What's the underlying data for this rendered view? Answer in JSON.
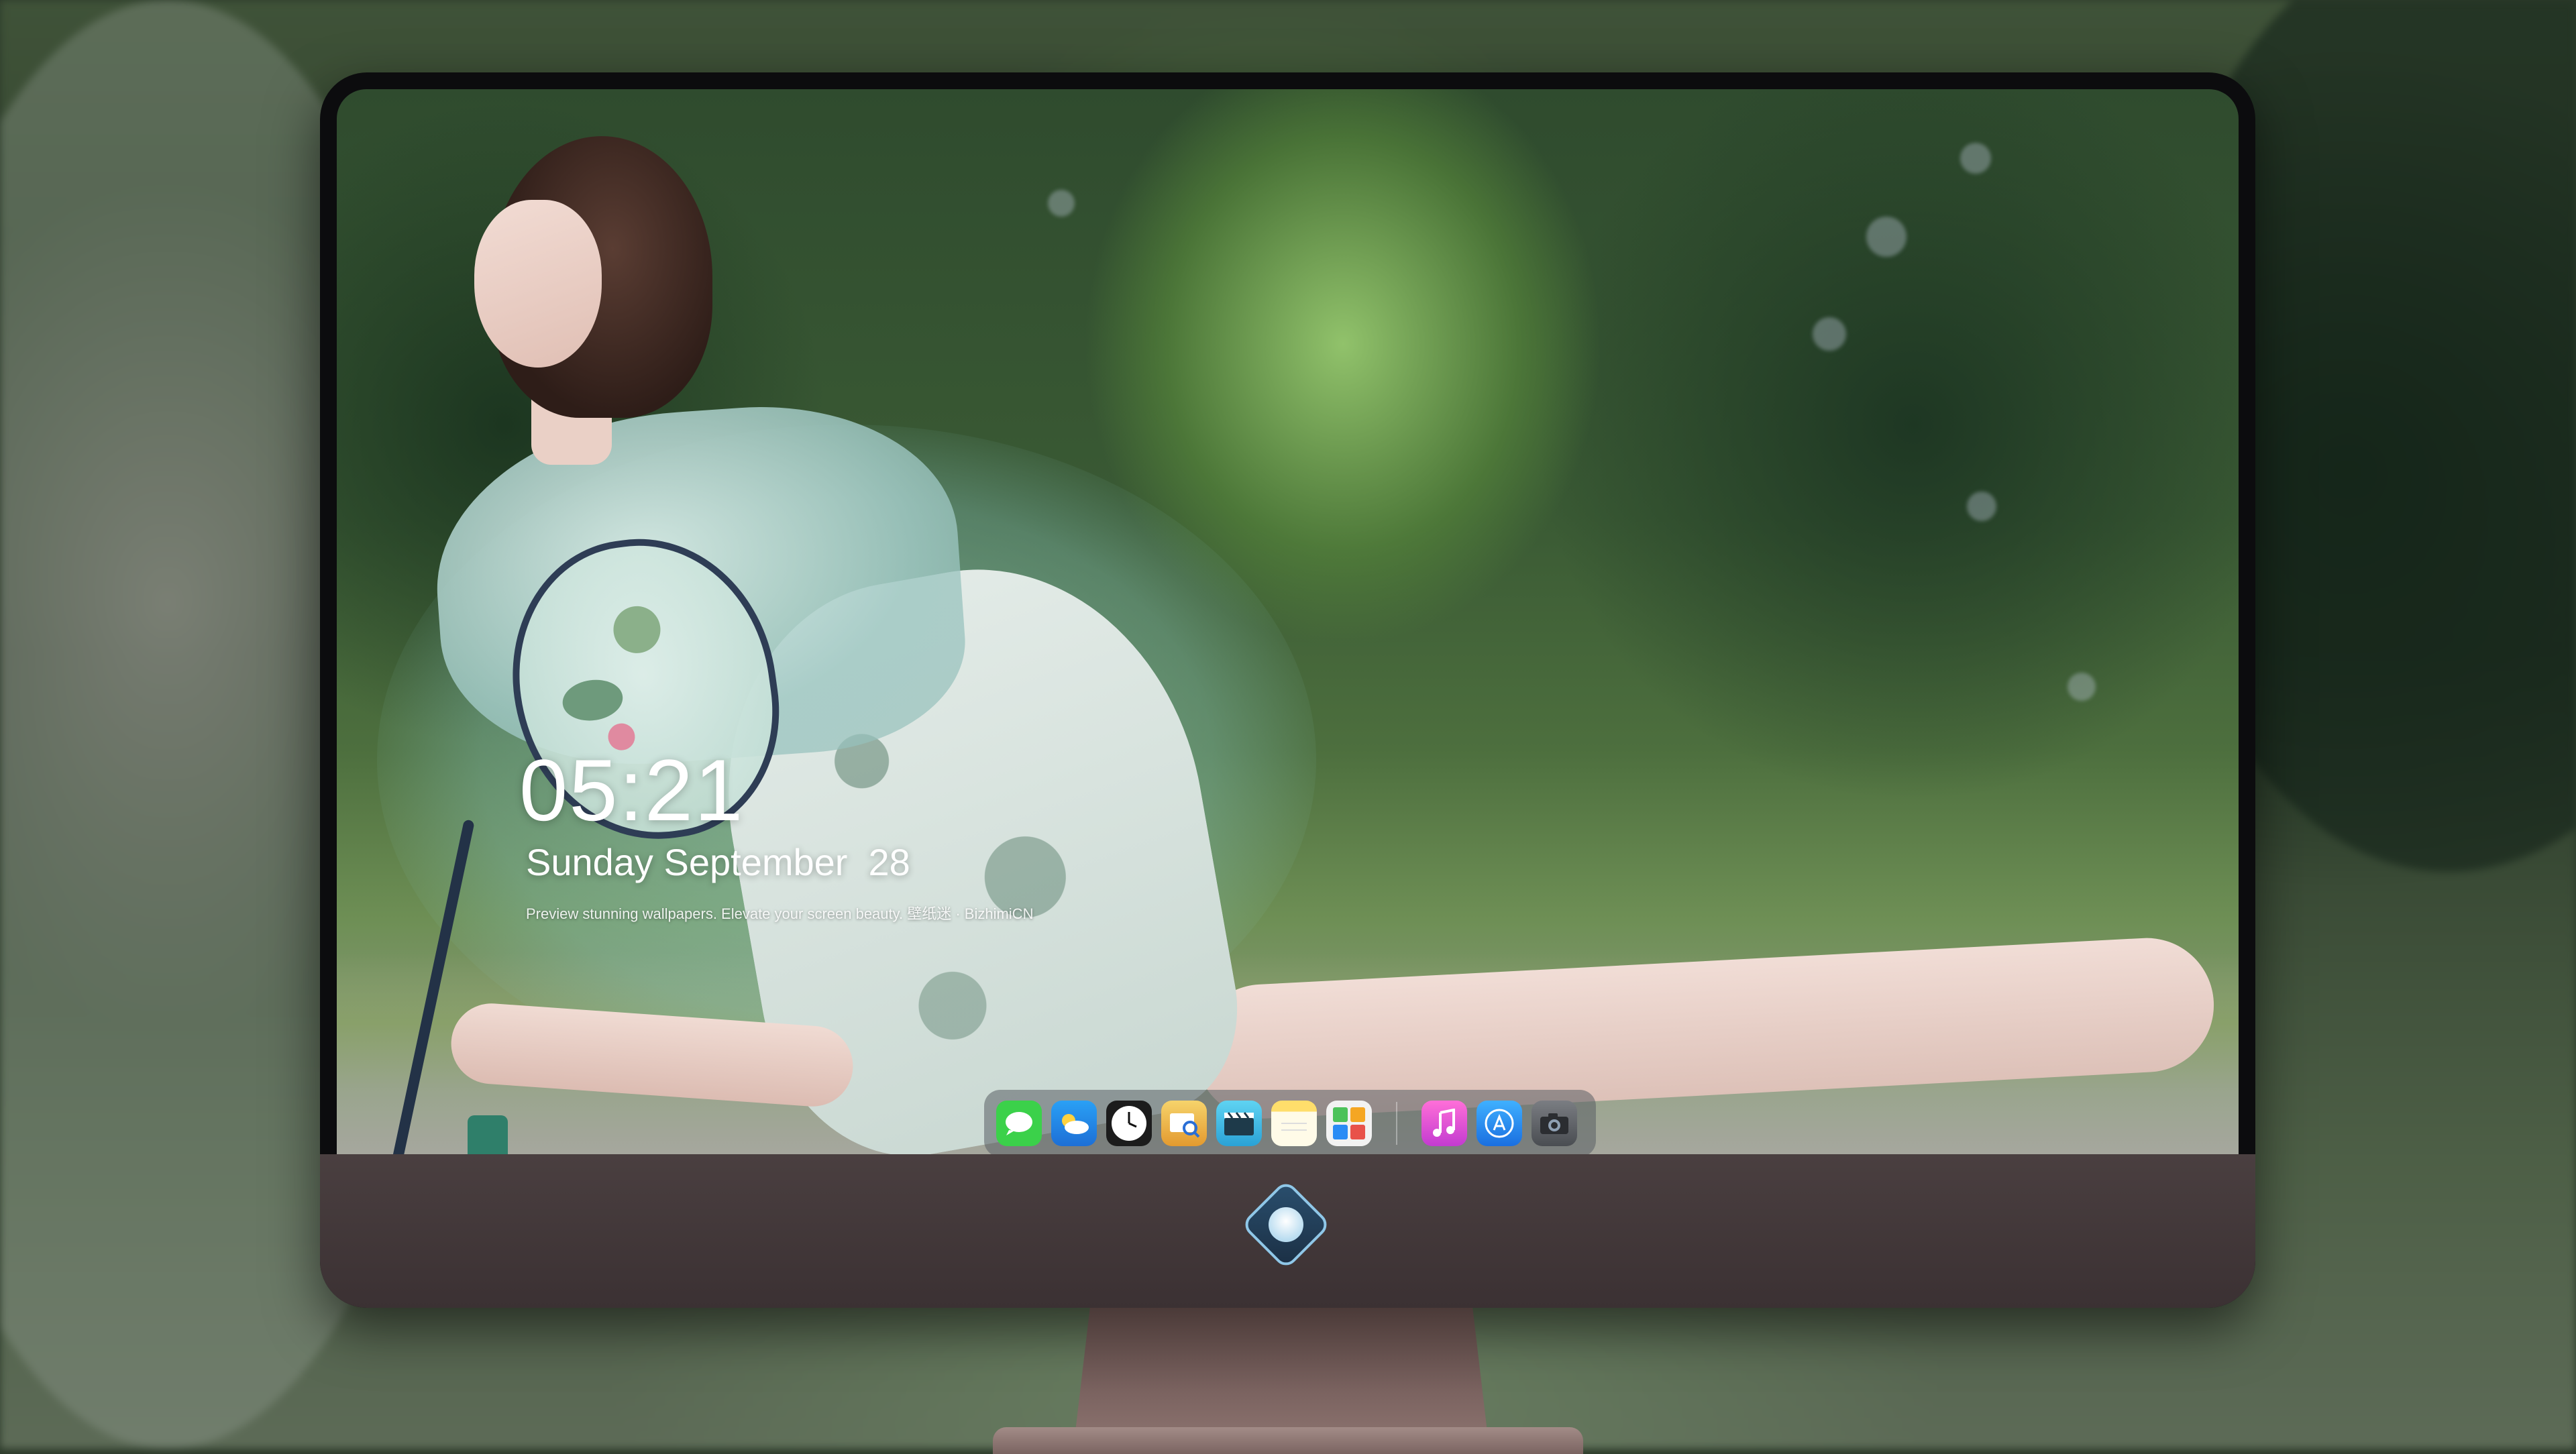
{
  "lockscreen": {
    "time": "05:21",
    "date": "Sunday September  28",
    "tagline": "Preview stunning wallpapers. Elevate your screen beauty. 壁纸迷 · BizhimiCN"
  },
  "dock": {
    "apps": [
      {
        "name": "Messages",
        "icon": "messages-icon",
        "color": "#3bd14a"
      },
      {
        "name": "Weather",
        "icon": "weather-icon",
        "color": "#2d8ff0"
      },
      {
        "name": "Clock",
        "icon": "clock-icon",
        "color": "#1c1c1c"
      },
      {
        "name": "Preview",
        "icon": "preview-icon",
        "color": "#e9b24a"
      },
      {
        "name": "Clips",
        "icon": "clips-icon",
        "color": "#3ec0e8"
      },
      {
        "name": "Notes",
        "icon": "notes-icon",
        "color": "#ffd34a"
      },
      {
        "name": "Calendar Widget",
        "icon": "calendar-icon",
        "color": "#f2f2f2"
      },
      {
        "name": "Music",
        "icon": "music-icon",
        "color": "#f04fc3"
      },
      {
        "name": "App Store",
        "icon": "app-store-icon",
        "color": "#2a8cf5"
      },
      {
        "name": "Camera",
        "icon": "camera-icon",
        "color": "#5a5d62"
      }
    ]
  },
  "monitor": {
    "logo": "monitor-logo-icon"
  }
}
